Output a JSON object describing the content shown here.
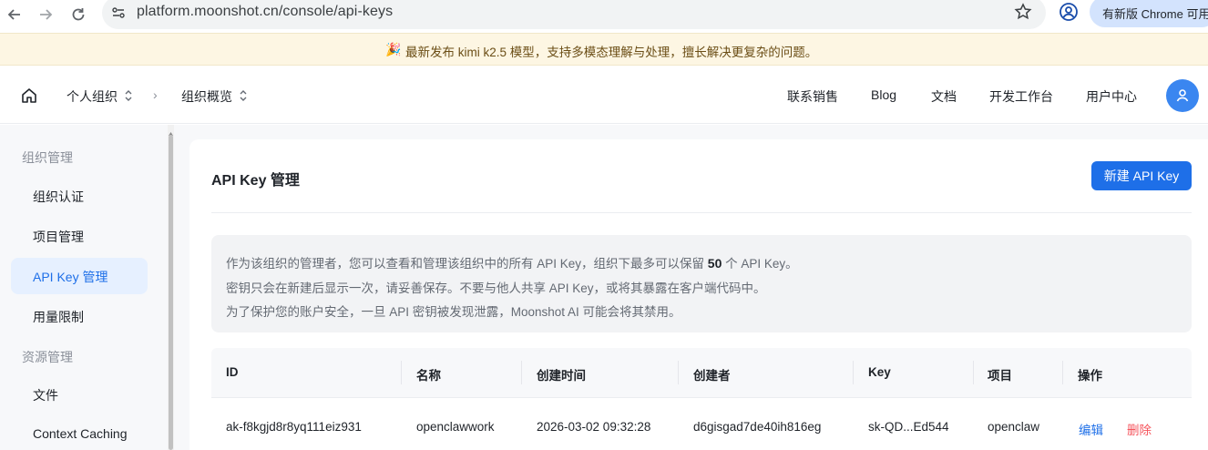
{
  "browser": {
    "url": "platform.moonshot.cn/console/api-keys",
    "update_label": "有新版 Chrome 可用"
  },
  "banner": {
    "icon": "🎉",
    "text": "最新发布 kimi k2.5 模型，支持多模态理解与处理，擅长解决更复杂的问题。"
  },
  "topnav": {
    "org": "个人组织",
    "crumb": "组织概览",
    "links": [
      "联系销售",
      "Blog",
      "文档",
      "开发工作台",
      "用户中心"
    ]
  },
  "sidebar": {
    "group1": "组织管理",
    "items1": [
      "组织认证",
      "项目管理",
      "API Key 管理",
      "用量限制"
    ],
    "group2": "资源管理",
    "items2": [
      "文件",
      "Context Caching"
    ],
    "active": "API Key 管理"
  },
  "main": {
    "title": "API Key 管理",
    "new_button": "新建 API Key",
    "notice": {
      "line1_pre": "作为该组织的管理者，您可以查看和管理该组织中的所有 API Key，组织下最多可以保留 ",
      "line1_num": "50",
      "line1_post": " 个 API Key。",
      "line2": "密钥只会在新建后显示一次，请妥善保存。不要与他人共享 API Key，或将其暴露在客户端代码中。",
      "line3": "为了保护您的账户安全，一旦 API 密钥被发现泄露，Moonshot AI 可能会将其禁用。"
    },
    "table": {
      "headers": [
        "ID",
        "名称",
        "创建时间",
        "创建者",
        "Key",
        "项目",
        "操作"
      ],
      "rows": [
        {
          "id": "ak-f8kgjd8r8yq111eiz931",
          "name": "openclawwork",
          "created": "2026-03-02 09:32:28",
          "creator": "d6gisgad7de40ih816eg",
          "key": "sk-QD...Ed544",
          "project": "openclaw",
          "edit": "编辑",
          "delete": "删除"
        }
      ]
    }
  }
}
